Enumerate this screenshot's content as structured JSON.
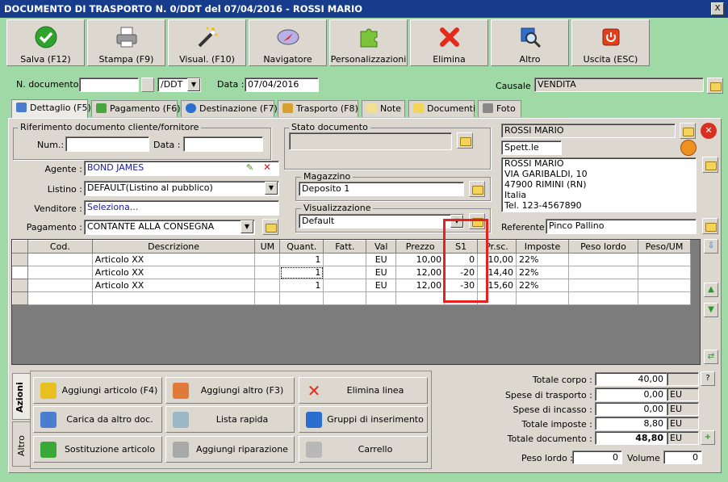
{
  "title": "DOCUMENTO DI TRASPORTO N. 0/DDT del 07/04/2016 - ROSSI MARIO",
  "close": "X",
  "toolbar": [
    "Salva (F12)",
    "Stampa (F9)",
    "Visual. (F10)",
    "Navigatore",
    "Personalizzazioni",
    "Elimina",
    "Altro",
    "Uscita (ESC)"
  ],
  "header": {
    "ndoc_label": "N. documento :",
    "ndoc_value": "",
    "series": "/DDT",
    "data_label": "Data :",
    "data_value": "07/04/2016",
    "causale_label": "Causale :",
    "causale_value": "VENDITA"
  },
  "tabs": [
    "Dettaglio (F5)",
    "Pagamento (F6)",
    "Destinazione (F7)",
    "Trasporto (F8)",
    "Note",
    "Documenti",
    "Foto"
  ],
  "rif": {
    "title": "Riferimento documento cliente/fornitore",
    "num_label": "Num.:",
    "num_value": "",
    "data_label": "Data :",
    "data_value": ""
  },
  "stato": {
    "title": "Stato documento",
    "value": ""
  },
  "agente": {
    "label": "Agente :",
    "value": "BOND JAMES"
  },
  "listino": {
    "label": "Listino :",
    "value": "DEFAULT(Listino al pubblico)"
  },
  "venditore": {
    "label": "Venditore :",
    "value": "Seleziona..."
  },
  "pagamento": {
    "label": "Pagamento :",
    "value": "CONTANTE ALLA CONSEGNA"
  },
  "magazzino": {
    "title": "Magazzino",
    "value": "Deposito 1"
  },
  "visualizzazione": {
    "title": "Visualizzazione",
    "value": "Default"
  },
  "cliente": {
    "name": "ROSSI MARIO",
    "type": "Spett.le",
    "address": [
      "ROSSI MARIO",
      "VIA GARIBALDI, 10",
      "47900 RIMINI (RN)",
      "Italia",
      "Tel. 123-4567890"
    ],
    "ref_label": "Referente",
    "ref_value": "Pinco Pallino"
  },
  "grid": {
    "headers": [
      "Cod.",
      "Descrizione",
      "UM",
      "Quant.",
      "Fatt.",
      "Val",
      "Prezzo",
      "S1",
      "Pr.sc.",
      "Imposte",
      "Peso lordo",
      "Peso/UM"
    ],
    "rows": [
      [
        "",
        "Articolo XX",
        "",
        "1",
        "",
        "EU",
        "10,00",
        "0",
        "10,00",
        "22%",
        "",
        ""
      ],
      [
        "",
        "Articolo XX",
        "",
        "1",
        "",
        "EU",
        "12,00",
        "-20",
        "14,40",
        "22%",
        "",
        ""
      ],
      [
        "",
        "Articolo XX",
        "",
        "1",
        "",
        "EU",
        "12,00",
        "-30",
        "15,60",
        "22%",
        "",
        ""
      ]
    ]
  },
  "side_tabs": [
    "Azioni",
    "Altro"
  ],
  "actions": [
    "Aggiungi articolo (F4)",
    "Aggiungi altro (F3)",
    "Elimina linea",
    "Carica da altro doc.",
    "Lista rapida",
    "Gruppi di inserimento",
    "Sostituzione articolo",
    "Aggiungi riparazione",
    "Carrello"
  ],
  "totals": {
    "corpo_label": "Totale corpo :",
    "corpo": "40,00",
    "trasporto_label": "Spese di trasporto :",
    "trasporto": "0,00",
    "incasso_label": "Spese di incasso :",
    "incasso": "0,00",
    "imposte_label": "Totale imposte :",
    "imposte": "8,80",
    "documento_label": "Totale documento :",
    "documento": "48,80",
    "currency": "EU",
    "help": "?",
    "peso_label": "Peso lordo :",
    "peso": "0",
    "volume_label": "Volume :",
    "volume": "0"
  },
  "colors": {
    "background": "#9fd9a5",
    "titlebar": "#173c8c",
    "highlight": "#e8201e"
  }
}
